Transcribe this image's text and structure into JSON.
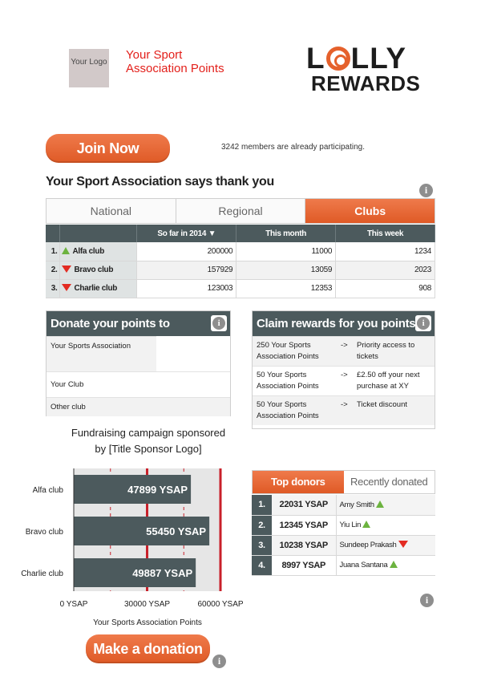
{
  "header": {
    "logo_placeholder": "Your Logo",
    "title": "Your Sport Association Points",
    "brand_line1_a": "L",
    "brand_line1_b": "LLY",
    "brand_line2": "REWARDS"
  },
  "join": {
    "button_label": "Join Now",
    "members_count": "3242",
    "members_text": " members are already participating."
  },
  "thanks_heading": "Your Sport Association says thank you",
  "tabs": [
    {
      "label": "National",
      "active": false
    },
    {
      "label": "Regional",
      "active": false
    },
    {
      "label": "Clubs",
      "active": true
    }
  ],
  "clubs_table": {
    "columns": [
      "So far in 2014",
      "This month",
      "This week"
    ],
    "rows": [
      {
        "rank": "1.",
        "trend": "up",
        "name": "Alfa club",
        "values": [
          "200000",
          "11000",
          "1234"
        ]
      },
      {
        "rank": "2.",
        "trend": "down",
        "name": "Bravo club",
        "values": [
          "157929",
          "13059",
          "2023"
        ]
      },
      {
        "rank": "3.",
        "trend": "down",
        "name": "Charlie club",
        "values": [
          "123003",
          "12353",
          "908"
        ]
      }
    ]
  },
  "donate_panel": {
    "title": "Donate your points to",
    "items": [
      "Your Sports Association",
      "Your Club",
      "Other club"
    ]
  },
  "claim_panel": {
    "title": "Claim rewards for you points",
    "arrow": "->",
    "items": [
      {
        "cost": "250 Your Sports Association Points",
        "reward": "Priority access to tickets"
      },
      {
        "cost": "50 Your Sports Association Points",
        "reward": "£2.50 off your next purchase at XY"
      },
      {
        "cost": "50 Your Sports Association Points",
        "reward": "Ticket discount"
      }
    ]
  },
  "fundraising": {
    "line1": "Fundraising campaign sponsored",
    "line2": "by [Title Sponsor Logo]"
  },
  "chart_data": {
    "type": "bar",
    "orientation": "horizontal",
    "categories": [
      "Alfa club",
      "Bravo club",
      "Charlie club"
    ],
    "values": [
      47899,
      55450,
      49887
    ],
    "value_labels": [
      "47899 YSAP",
      "55450 YSAP",
      "49887 YSAP"
    ],
    "tick_labels": [
      "0 YSAP",
      "30000 YSAP",
      "60000 YSAP"
    ],
    "ticks": [
      0,
      30000,
      60000
    ],
    "xlim": [
      0,
      60000
    ],
    "xlabel": "Your Sports Association Points",
    "bar_color": "#4c5a5d",
    "target_line_color": "#c8202a"
  },
  "donors": {
    "tabs": [
      {
        "label": "Top donors",
        "active": true
      },
      {
        "label": "Recently donated",
        "active": false
      }
    ],
    "rows": [
      {
        "rank": "1.",
        "value": "22031 YSAP",
        "name": "Amy Smith",
        "trend": "up"
      },
      {
        "rank": "2.",
        "value": "12345 YSAP",
        "name": "Yiu Lin",
        "trend": "up"
      },
      {
        "rank": "3.",
        "value": "10238 YSAP",
        "name": "Sundeep Prakash",
        "trend": "down"
      },
      {
        "rank": "4.",
        "value": "8997 YSAP",
        "name": "Juana Santana",
        "trend": "up"
      }
    ]
  },
  "donation_button_label": "Make a donation",
  "icons": {
    "info": "i"
  },
  "colors": {
    "accent": "#e5612c",
    "dark": "#4c5a5d",
    "up": "#6cb33f",
    "down": "#e32b22",
    "title_red": "#e3201b"
  }
}
